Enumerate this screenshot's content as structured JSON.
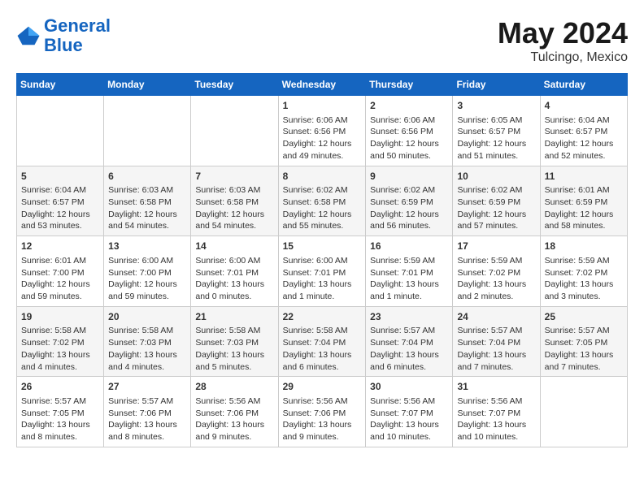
{
  "header": {
    "logo_line1": "General",
    "logo_line2": "Blue",
    "month": "May 2024",
    "location": "Tulcingo, Mexico"
  },
  "days_of_week": [
    "Sunday",
    "Monday",
    "Tuesday",
    "Wednesday",
    "Thursday",
    "Friday",
    "Saturday"
  ],
  "weeks": [
    [
      {
        "day": "",
        "content": ""
      },
      {
        "day": "",
        "content": ""
      },
      {
        "day": "",
        "content": ""
      },
      {
        "day": "1",
        "content": "Sunrise: 6:06 AM\nSunset: 6:56 PM\nDaylight: 12 hours\nand 49 minutes."
      },
      {
        "day": "2",
        "content": "Sunrise: 6:06 AM\nSunset: 6:56 PM\nDaylight: 12 hours\nand 50 minutes."
      },
      {
        "day": "3",
        "content": "Sunrise: 6:05 AM\nSunset: 6:57 PM\nDaylight: 12 hours\nand 51 minutes."
      },
      {
        "day": "4",
        "content": "Sunrise: 6:04 AM\nSunset: 6:57 PM\nDaylight: 12 hours\nand 52 minutes."
      }
    ],
    [
      {
        "day": "5",
        "content": "Sunrise: 6:04 AM\nSunset: 6:57 PM\nDaylight: 12 hours\nand 53 minutes."
      },
      {
        "day": "6",
        "content": "Sunrise: 6:03 AM\nSunset: 6:58 PM\nDaylight: 12 hours\nand 54 minutes."
      },
      {
        "day": "7",
        "content": "Sunrise: 6:03 AM\nSunset: 6:58 PM\nDaylight: 12 hours\nand 54 minutes."
      },
      {
        "day": "8",
        "content": "Sunrise: 6:02 AM\nSunset: 6:58 PM\nDaylight: 12 hours\nand 55 minutes."
      },
      {
        "day": "9",
        "content": "Sunrise: 6:02 AM\nSunset: 6:59 PM\nDaylight: 12 hours\nand 56 minutes."
      },
      {
        "day": "10",
        "content": "Sunrise: 6:02 AM\nSunset: 6:59 PM\nDaylight: 12 hours\nand 57 minutes."
      },
      {
        "day": "11",
        "content": "Sunrise: 6:01 AM\nSunset: 6:59 PM\nDaylight: 12 hours\nand 58 minutes."
      }
    ],
    [
      {
        "day": "12",
        "content": "Sunrise: 6:01 AM\nSunset: 7:00 PM\nDaylight: 12 hours\nand 59 minutes."
      },
      {
        "day": "13",
        "content": "Sunrise: 6:00 AM\nSunset: 7:00 PM\nDaylight: 12 hours\nand 59 minutes."
      },
      {
        "day": "14",
        "content": "Sunrise: 6:00 AM\nSunset: 7:01 PM\nDaylight: 13 hours\nand 0 minutes."
      },
      {
        "day": "15",
        "content": "Sunrise: 6:00 AM\nSunset: 7:01 PM\nDaylight: 13 hours\nand 1 minute."
      },
      {
        "day": "16",
        "content": "Sunrise: 5:59 AM\nSunset: 7:01 PM\nDaylight: 13 hours\nand 1 minute."
      },
      {
        "day": "17",
        "content": "Sunrise: 5:59 AM\nSunset: 7:02 PM\nDaylight: 13 hours\nand 2 minutes."
      },
      {
        "day": "18",
        "content": "Sunrise: 5:59 AM\nSunset: 7:02 PM\nDaylight: 13 hours\nand 3 minutes."
      }
    ],
    [
      {
        "day": "19",
        "content": "Sunrise: 5:58 AM\nSunset: 7:02 PM\nDaylight: 13 hours\nand 4 minutes."
      },
      {
        "day": "20",
        "content": "Sunrise: 5:58 AM\nSunset: 7:03 PM\nDaylight: 13 hours\nand 4 minutes."
      },
      {
        "day": "21",
        "content": "Sunrise: 5:58 AM\nSunset: 7:03 PM\nDaylight: 13 hours\nand 5 minutes."
      },
      {
        "day": "22",
        "content": "Sunrise: 5:58 AM\nSunset: 7:04 PM\nDaylight: 13 hours\nand 6 minutes."
      },
      {
        "day": "23",
        "content": "Sunrise: 5:57 AM\nSunset: 7:04 PM\nDaylight: 13 hours\nand 6 minutes."
      },
      {
        "day": "24",
        "content": "Sunrise: 5:57 AM\nSunset: 7:04 PM\nDaylight: 13 hours\nand 7 minutes."
      },
      {
        "day": "25",
        "content": "Sunrise: 5:57 AM\nSunset: 7:05 PM\nDaylight: 13 hours\nand 7 minutes."
      }
    ],
    [
      {
        "day": "26",
        "content": "Sunrise: 5:57 AM\nSunset: 7:05 PM\nDaylight: 13 hours\nand 8 minutes."
      },
      {
        "day": "27",
        "content": "Sunrise: 5:57 AM\nSunset: 7:06 PM\nDaylight: 13 hours\nand 8 minutes."
      },
      {
        "day": "28",
        "content": "Sunrise: 5:56 AM\nSunset: 7:06 PM\nDaylight: 13 hours\nand 9 minutes."
      },
      {
        "day": "29",
        "content": "Sunrise: 5:56 AM\nSunset: 7:06 PM\nDaylight: 13 hours\nand 9 minutes."
      },
      {
        "day": "30",
        "content": "Sunrise: 5:56 AM\nSunset: 7:07 PM\nDaylight: 13 hours\nand 10 minutes."
      },
      {
        "day": "31",
        "content": "Sunrise: 5:56 AM\nSunset: 7:07 PM\nDaylight: 13 hours\nand 10 minutes."
      },
      {
        "day": "",
        "content": ""
      }
    ]
  ]
}
